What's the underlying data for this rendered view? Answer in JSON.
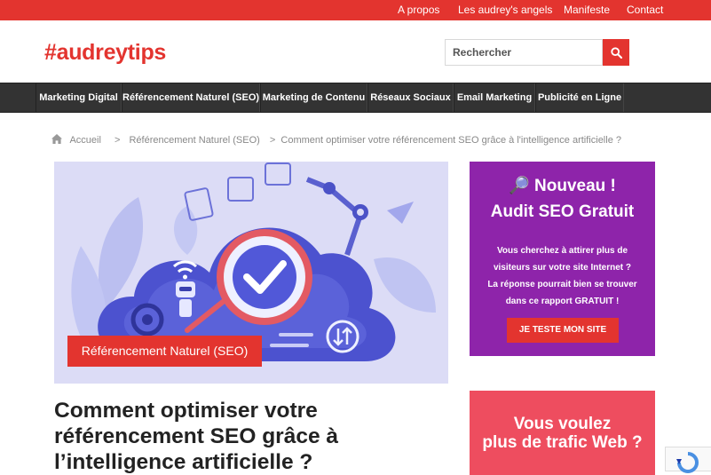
{
  "top_nav": [
    "A propos",
    "Les audrey's angels",
    "Manifeste",
    "Contact"
  ],
  "logo": "#audreytips",
  "search": {
    "placeholder": "Rechercher",
    "icon": "search-icon"
  },
  "main_nav": [
    "Marketing Digital",
    "Référencement Naturel (SEO)",
    "Marketing de Contenu",
    "Réseaux Sociaux",
    "Email Marketing",
    "Publicité en Ligne"
  ],
  "breadcrumb": {
    "home": "Accueil",
    "separator": ">",
    "category": "Référencement Naturel (SEO)",
    "current": "Comment optimiser votre référencement SEO grâce à l'intelligence artificielle ?"
  },
  "article": {
    "category": "Référencement Naturel (SEO)",
    "title": "Comment optimiser votre référencement SEO grâce à l’intelligence artificielle ?"
  },
  "promo_audit": {
    "line1": "🔎 Nouveau !",
    "line2": "Audit SEO Gratuit",
    "body": "Vous cherchez à attirer plus de visiteurs sur votre site Internet ? La réponse pourrait bien se trouver dans ce rapport GRATUIT !",
    "button": "JE TESTE MON SITE"
  },
  "promo_traffic": {
    "line1": "Vous voulez",
    "line2": "plus de trafic Web ?"
  },
  "colors": {
    "brand_red": "#e3342f",
    "nav_dark": "#333333",
    "promo_purple": "#8e24aa",
    "promo_pink": "#ee4d5f"
  }
}
